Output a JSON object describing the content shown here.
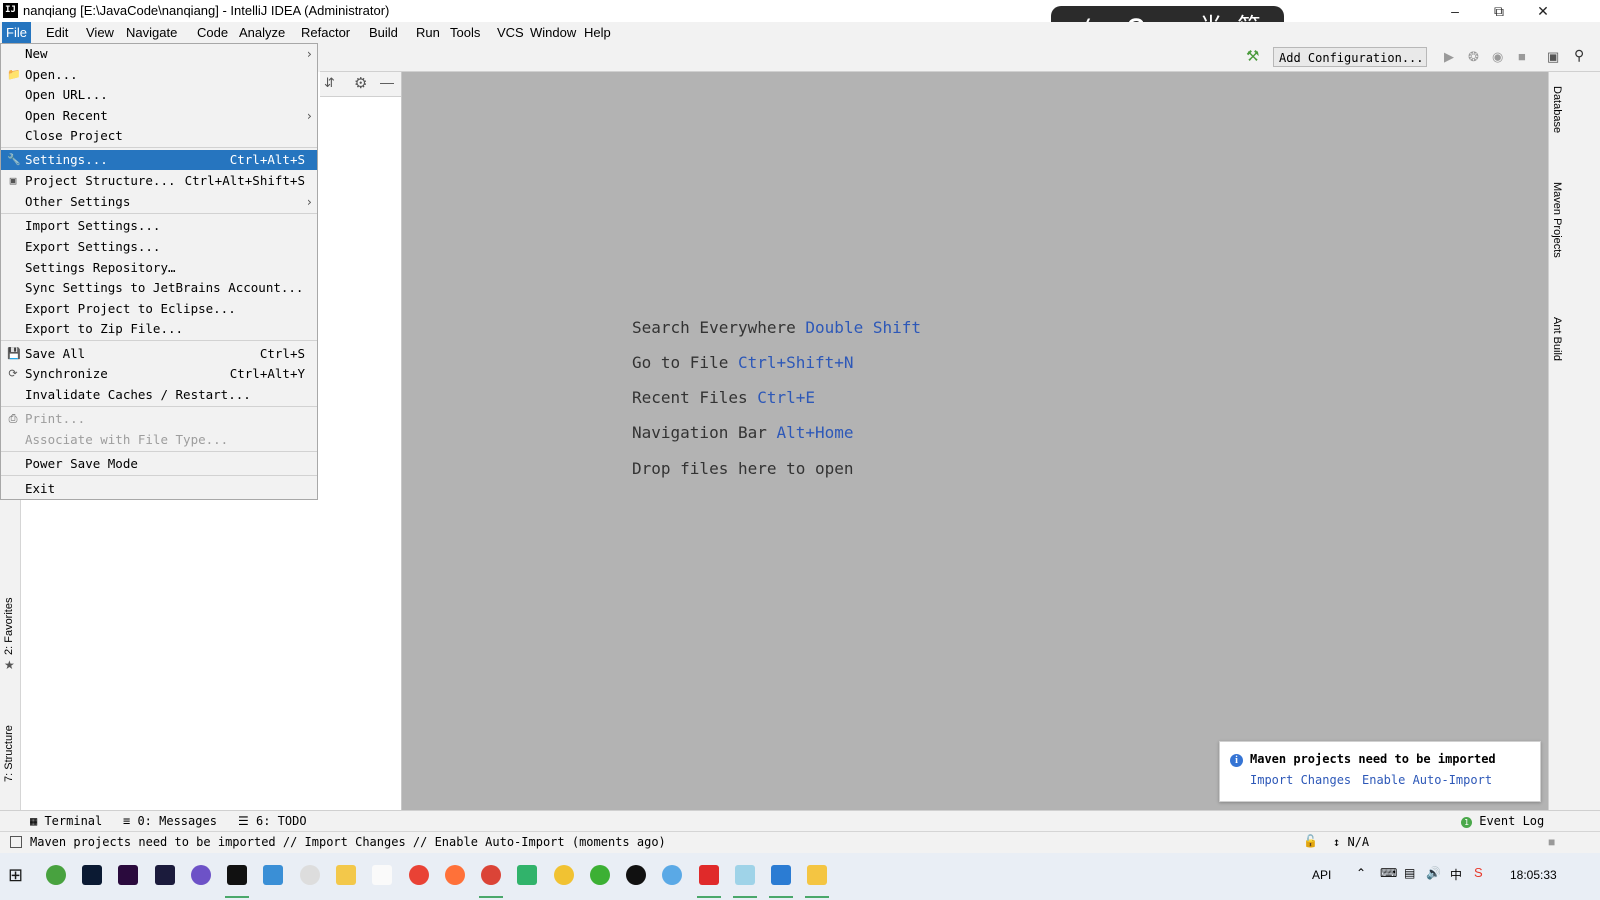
{
  "window": {
    "title": "nanqiang [E:\\JavaCode\\nanqiang] - IntelliJ IDEA (Administrator)",
    "app_icon": "IJ"
  },
  "menubar": [
    "File",
    "Edit",
    "View",
    "Navigate",
    "Code",
    "Analyze",
    "Refactor",
    "Build",
    "Run",
    "Tools",
    "VCS",
    "Window",
    "Help"
  ],
  "file_menu": {
    "items": [
      {
        "label": "New",
        "shortcut": "",
        "submenu": true,
        "icon": ""
      },
      {
        "label": "Open...",
        "shortcut": "",
        "submenu": false,
        "icon": "folder-icon"
      },
      {
        "label": "Open URL...",
        "shortcut": "",
        "submenu": false,
        "icon": ""
      },
      {
        "label": "Open Recent",
        "shortcut": "",
        "submenu": true,
        "icon": ""
      },
      {
        "label": "Close Project",
        "shortcut": "",
        "submenu": false,
        "icon": ""
      },
      {
        "label": "Settings...",
        "shortcut": "Ctrl+Alt+S",
        "submenu": false,
        "icon": "wrench-icon",
        "selected": true
      },
      {
        "label": "Project Structure...",
        "shortcut": "Ctrl+Alt+Shift+S",
        "submenu": false,
        "icon": "project-structure-icon"
      },
      {
        "label": "Other Settings",
        "shortcut": "",
        "submenu": true,
        "icon": ""
      },
      {
        "label": "Import Settings...",
        "shortcut": "",
        "submenu": false,
        "icon": ""
      },
      {
        "label": "Export Settings...",
        "shortcut": "",
        "submenu": false,
        "icon": ""
      },
      {
        "label": "Settings Repository…",
        "shortcut": "",
        "submenu": false,
        "icon": ""
      },
      {
        "label": "Sync Settings to JetBrains Account...",
        "shortcut": "",
        "submenu": false,
        "icon": ""
      },
      {
        "label": "Export Project to Eclipse...",
        "shortcut": "",
        "submenu": false,
        "icon": ""
      },
      {
        "label": "Export to Zip File...",
        "shortcut": "",
        "submenu": false,
        "icon": ""
      },
      {
        "label": "Save All",
        "shortcut": "Ctrl+S",
        "submenu": false,
        "icon": "save-icon"
      },
      {
        "label": "Synchronize",
        "shortcut": "Ctrl+Alt+Y",
        "submenu": false,
        "icon": "sync-icon"
      },
      {
        "label": "Invalidate Caches / Restart...",
        "shortcut": "",
        "submenu": false,
        "icon": ""
      },
      {
        "label": "Print...",
        "shortcut": "",
        "submenu": false,
        "icon": "print-icon",
        "disabled": true
      },
      {
        "label": "Associate with File Type...",
        "shortcut": "",
        "submenu": false,
        "icon": "",
        "disabled": true
      },
      {
        "label": "Power Save Mode",
        "shortcut": "",
        "submenu": false,
        "icon": ""
      },
      {
        "label": "Exit",
        "shortcut": "",
        "submenu": false,
        "icon": ""
      }
    ]
  },
  "toolbar": {
    "add_configuration": "Add Configuration..."
  },
  "editor_hints": [
    {
      "text": "Search Everywhere",
      "key": "Double Shift"
    },
    {
      "text": "Go to File",
      "key": "Ctrl+Shift+N"
    },
    {
      "text": "Recent Files",
      "key": "Ctrl+E"
    },
    {
      "text": "Navigation Bar",
      "key": "Alt+Home"
    },
    {
      "text": "Drop files here to open",
      "key": ""
    }
  ],
  "right_tools": [
    "Database",
    "Maven Projects",
    "Ant Build"
  ],
  "left_tools": [
    "2: Favorites",
    "7: Structure"
  ],
  "bottom_tools": {
    "terminal": "Terminal",
    "messages": "0: Messages",
    "todo": "6: TODO",
    "event_log": "Event Log"
  },
  "notification": {
    "title": "Maven projects need to be imported",
    "link1": "Import Changes",
    "link2": "Enable Auto-Import"
  },
  "status": {
    "message": "Maven projects need to be imported // Import Changes // Enable Auto-Import (moments ago)",
    "position": "N/A"
  },
  "ime": {
    "code": "</>",
    "lang": "Cn",
    "punct": "。",
    "width": "半",
    "script": "简"
  },
  "taskbar": {
    "lang": "API",
    "time": "18:05:33"
  },
  "colors": {
    "accent": "#2675bf",
    "link": "#2d58b8",
    "editor_bg": "#b3b3b3"
  }
}
